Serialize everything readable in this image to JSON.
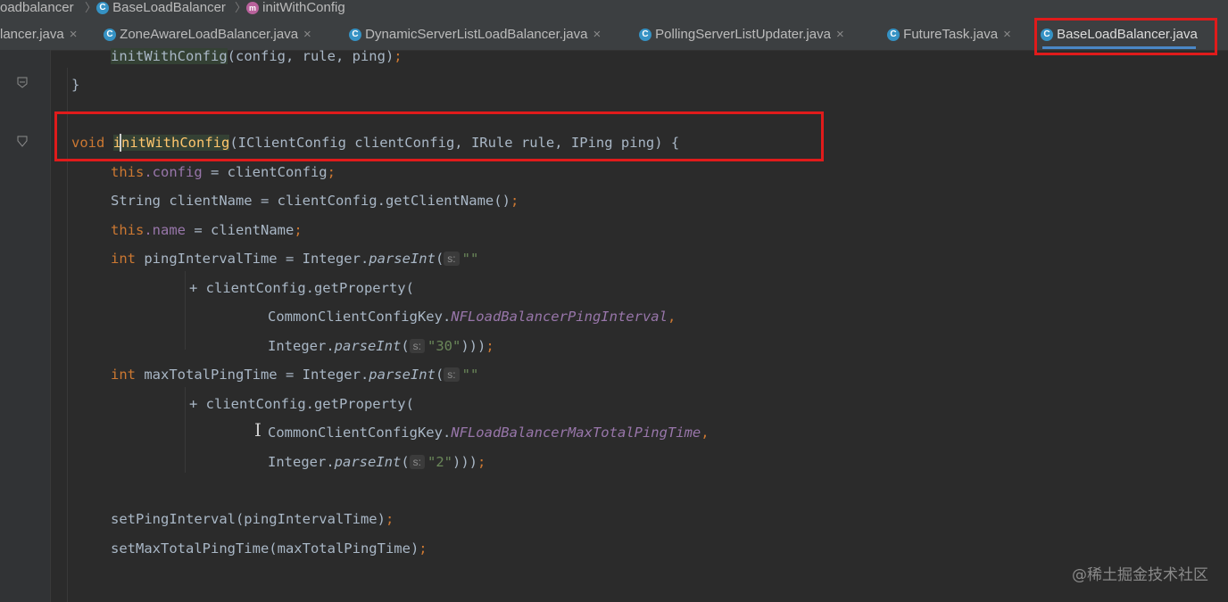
{
  "breadcrumb": {
    "items": [
      "oadbalancer",
      "BaseLoadBalancer",
      "initWithConfig"
    ],
    "class_icon": "C",
    "method_icon": "m"
  },
  "tabs": [
    {
      "label": "lancer.java",
      "icon": "class-icon",
      "active": false
    },
    {
      "label": "ZoneAwareLoadBalancer.java",
      "icon": "class-icon",
      "active": false
    },
    {
      "label": "DynamicServerListLoadBalancer.java",
      "icon": "class-icon",
      "active": false
    },
    {
      "label": "PollingServerListUpdater.java",
      "icon": "class-icon",
      "active": false
    },
    {
      "label": "FutureTask.java",
      "icon": "class-icon",
      "active": false
    },
    {
      "label": "BaseLoadBalancer.java",
      "icon": "class-icon",
      "active": true
    }
  ],
  "tab_close_symbol": "×",
  "code": {
    "l1_call": "initWithConfig",
    "l1_args": "(config, rule, ping)",
    "l2_brace": "}",
    "l3_void": "void",
    "l3_name": "initWithConfig",
    "l3_params": "(IClientConfig clientConfig, IRule rule, IPing ping) {",
    "l4_this": "this",
    "l4_field": ".config",
    "l4_rest": " = clientConfig",
    "l5_text": "String clientName = clientConfig.getClientName()",
    "l6_this": "this",
    "l6_field": ".name",
    "l6_rest": " = clientName",
    "l7_int": "int",
    "l7_mid": " pingIntervalTime = Integer.",
    "l7_method": "parseInt",
    "l7_paren": "(",
    "hint_s": "s:",
    "l7_str": "\"\"",
    "l8_text": "+ clientConfig.getProperty(",
    "l9_class": "CommonClientConfigKey.",
    "l9_const": "NFLoadBalancerPingInterval",
    "l10_pre": "Integer.",
    "l10_method": "parseInt",
    "l10_paren": "(",
    "l10_str": "\"30\"",
    "l10_end": ")))",
    "l11_int": "int",
    "l11_mid": " maxTotalPingTime = Integer.",
    "l11_method": "parseInt",
    "l11_paren": "(",
    "l11_str": "\"\"",
    "l12_text": "+ clientConfig.getProperty(",
    "l13_class": "CommonClientConfigKey.",
    "l13_const": "NFLoadBalancerMaxTotalPingTime",
    "l14_pre": "Integer.",
    "l14_method": "parseInt",
    "l14_paren": "(",
    "l14_str": "\"2\"",
    "l14_end": ")))",
    "l15_text": "setPingInterval(pingIntervalTime)",
    "l16_text": "setMaxTotalPingTime(maxTotalPingTime)",
    "semicolon": ";",
    "comma": ","
  },
  "watermark": "@稀土掘金技术社区",
  "colors": {
    "highlight": "#e01b1b",
    "active_tab_underline": "#4a88c7",
    "keyword": "#cc7832",
    "field": "#9876aa",
    "string": "#6a8759"
  }
}
